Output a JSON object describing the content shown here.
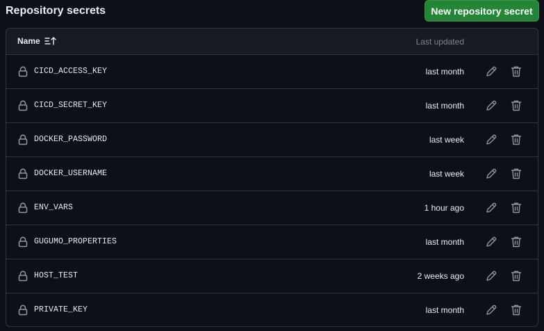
{
  "page": {
    "title": "Repository secrets",
    "new_button_label": "New repository secret"
  },
  "table": {
    "columns": {
      "name": "Name",
      "last_updated": "Last updated"
    },
    "rows": [
      {
        "name": "CICD_ACCESS_KEY",
        "updated": "last month"
      },
      {
        "name": "CICD_SECRET_KEY",
        "updated": "last month"
      },
      {
        "name": "DOCKER_PASSWORD",
        "updated": "last week"
      },
      {
        "name": "DOCKER_USERNAME",
        "updated": "last week"
      },
      {
        "name": "ENV_VARS",
        "updated": "1 hour ago"
      },
      {
        "name": "GUGUMO_PROPERTIES",
        "updated": "last month"
      },
      {
        "name": "HOST_TEST",
        "updated": "2 weeks ago"
      },
      {
        "name": "PRIVATE_KEY",
        "updated": "last month"
      }
    ]
  },
  "colors": {
    "background": "#0d1117",
    "header_bg": "#161b22",
    "border": "#30363d",
    "primary_button": "#238636",
    "muted_text": "#7d8590",
    "icon": "#9198a1"
  },
  "icons": {
    "row_icon": "lock-icon",
    "edit_icon": "pencil-icon",
    "delete_icon": "trash-icon",
    "sort_icon": "sort-ascending-icon"
  }
}
